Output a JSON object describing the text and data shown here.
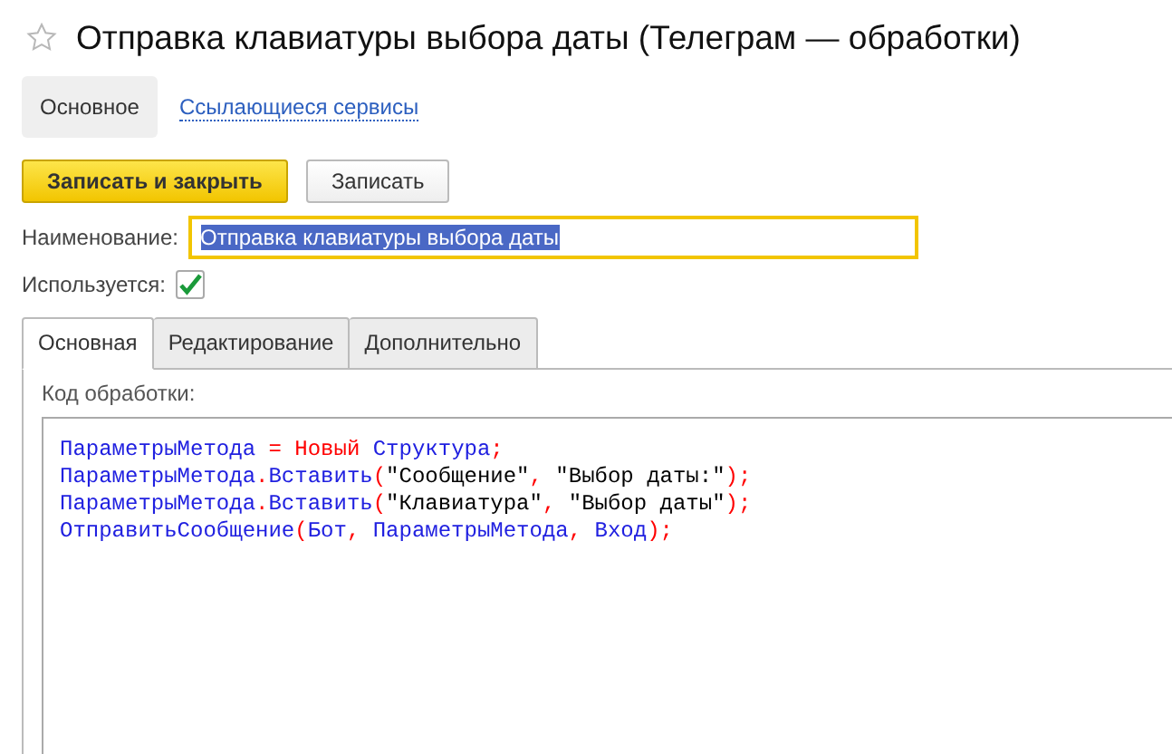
{
  "window": {
    "title": "Отправка клавиатуры выбора даты (Телеграм — обработки)",
    "favorite": false
  },
  "nav": [
    {
      "label": "Основное",
      "selected": true
    },
    {
      "label": "Ссылающиеся сервисы",
      "selected": false
    }
  ],
  "buttons": [
    {
      "label": "Записать и закрыть",
      "kind": "primary"
    },
    {
      "label": "Записать",
      "kind": "default"
    }
  ],
  "name_field": {
    "label": "Наименование:",
    "value": "Отправка клавиатуры выбора даты",
    "text_selected": true
  },
  "used": {
    "label": "Используется:",
    "checked": true
  },
  "tabs": [
    {
      "label": "Основная",
      "selected": true
    },
    {
      "label": "Редактирование",
      "selected": false
    },
    {
      "label": "Дополнительно",
      "selected": false
    }
  ],
  "code": {
    "label": "Код обработки:",
    "lines": [
      [
        {
          "text": "ПараметрыМетода",
          "kind": "ident"
        },
        {
          "text": " = ",
          "kind": "op"
        },
        {
          "text": "Новый",
          "kind": "op"
        },
        {
          "text": " Структура",
          "kind": "ident"
        },
        {
          "text": ";",
          "kind": "op"
        }
      ],
      [
        {
          "text": "ПараметрыМетода",
          "kind": "ident"
        },
        {
          "text": ".",
          "kind": "op"
        },
        {
          "text": "Вставить",
          "kind": "ident"
        },
        {
          "text": "(",
          "kind": "op"
        },
        {
          "text": "\"Сообщение\"",
          "kind": "string"
        },
        {
          "text": ", ",
          "kind": "op"
        },
        {
          "text": "\"Выбор даты:\"",
          "kind": "string"
        },
        {
          "text": ");",
          "kind": "op"
        }
      ],
      [
        {
          "text": "ПараметрыМетода",
          "kind": "ident"
        },
        {
          "text": ".",
          "kind": "op"
        },
        {
          "text": "Вставить",
          "kind": "ident"
        },
        {
          "text": "(",
          "kind": "op"
        },
        {
          "text": "\"Клавиатура\"",
          "kind": "string"
        },
        {
          "text": ", ",
          "kind": "op"
        },
        {
          "text": "\"Выбор даты\"",
          "kind": "string"
        },
        {
          "text": ");",
          "kind": "op"
        }
      ],
      [
        {
          "text": "ОтправитьСообщение",
          "kind": "ident"
        },
        {
          "text": "(",
          "kind": "op"
        },
        {
          "text": "Бот",
          "kind": "ident"
        },
        {
          "text": ", ",
          "kind": "op"
        },
        {
          "text": "ПараметрыМетода",
          "kind": "ident"
        },
        {
          "text": ", ",
          "kind": "op"
        },
        {
          "text": "Вход",
          "kind": "ident"
        },
        {
          "text": ");",
          "kind": "op"
        }
      ]
    ]
  }
}
